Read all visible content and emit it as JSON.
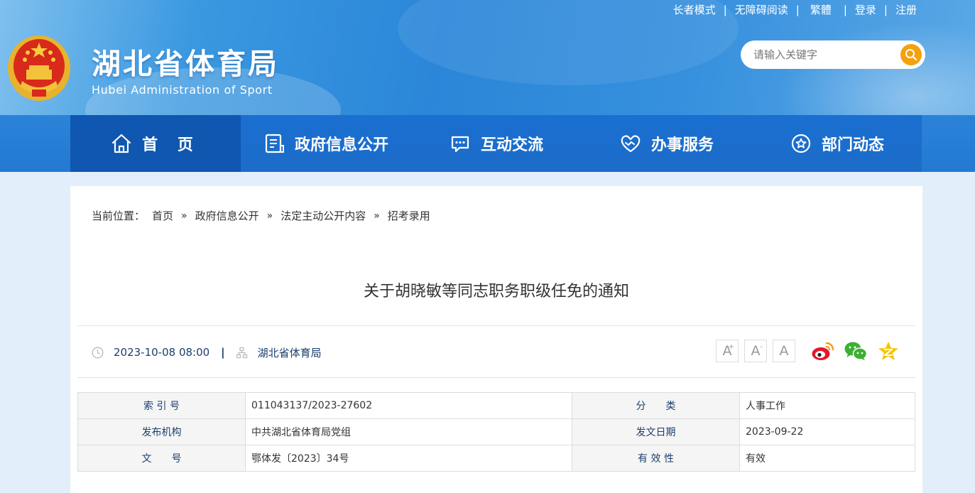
{
  "site": {
    "title": "湖北省体育局",
    "subtitle": "Hubei Administration of Sport"
  },
  "toplinks": [
    "长者模式",
    "无障碍阅读",
    "繁體",
    "登录",
    "注册"
  ],
  "search": {
    "placeholder": "请输入关键字"
  },
  "nav": [
    {
      "label": "首 页",
      "icon": "home-icon"
    },
    {
      "label": "政府信息公开",
      "icon": "document-icon"
    },
    {
      "label": "互动交流",
      "icon": "chat-icon"
    },
    {
      "label": "办事服务",
      "icon": "heart-hands-icon"
    },
    {
      "label": "部门动态",
      "icon": "star-circle-icon"
    }
  ],
  "breadcrumb": {
    "prefix": "当前位置：",
    "items": [
      "首页",
      "政府信息公开",
      "法定主动公开内容",
      "招考录用"
    ],
    "separator": "»"
  },
  "article": {
    "title": "关于胡晓敏等同志职务职级任免的通知",
    "date": "2023-10-08 08:00",
    "source": "湖北省体育局"
  },
  "font_controls": [
    "A",
    "A",
    "A"
  ],
  "share": [
    "weibo-icon",
    "wechat-icon",
    "qzone-icon"
  ],
  "info_table": [
    {
      "k1": "索 引 号",
      "v1": "011043137/2023-27602",
      "k2": "分　　类",
      "v2": "人事工作"
    },
    {
      "k1": "发布机构",
      "v1": "中共湖北省体育局党组",
      "k2": "发文日期",
      "v2": "2023-09-22"
    },
    {
      "k1": "文　　号",
      "v1": "鄂体发〔2023〕34号",
      "k2": "有 效 性",
      "v2": "有效"
    }
  ],
  "colors": {
    "header_blue": "#2b86d9",
    "nav_blue": "#1a6fd0",
    "nav_active": "#0f57b0",
    "search_button": "#f4a10d",
    "meta_text": "#1b3f6e"
  }
}
